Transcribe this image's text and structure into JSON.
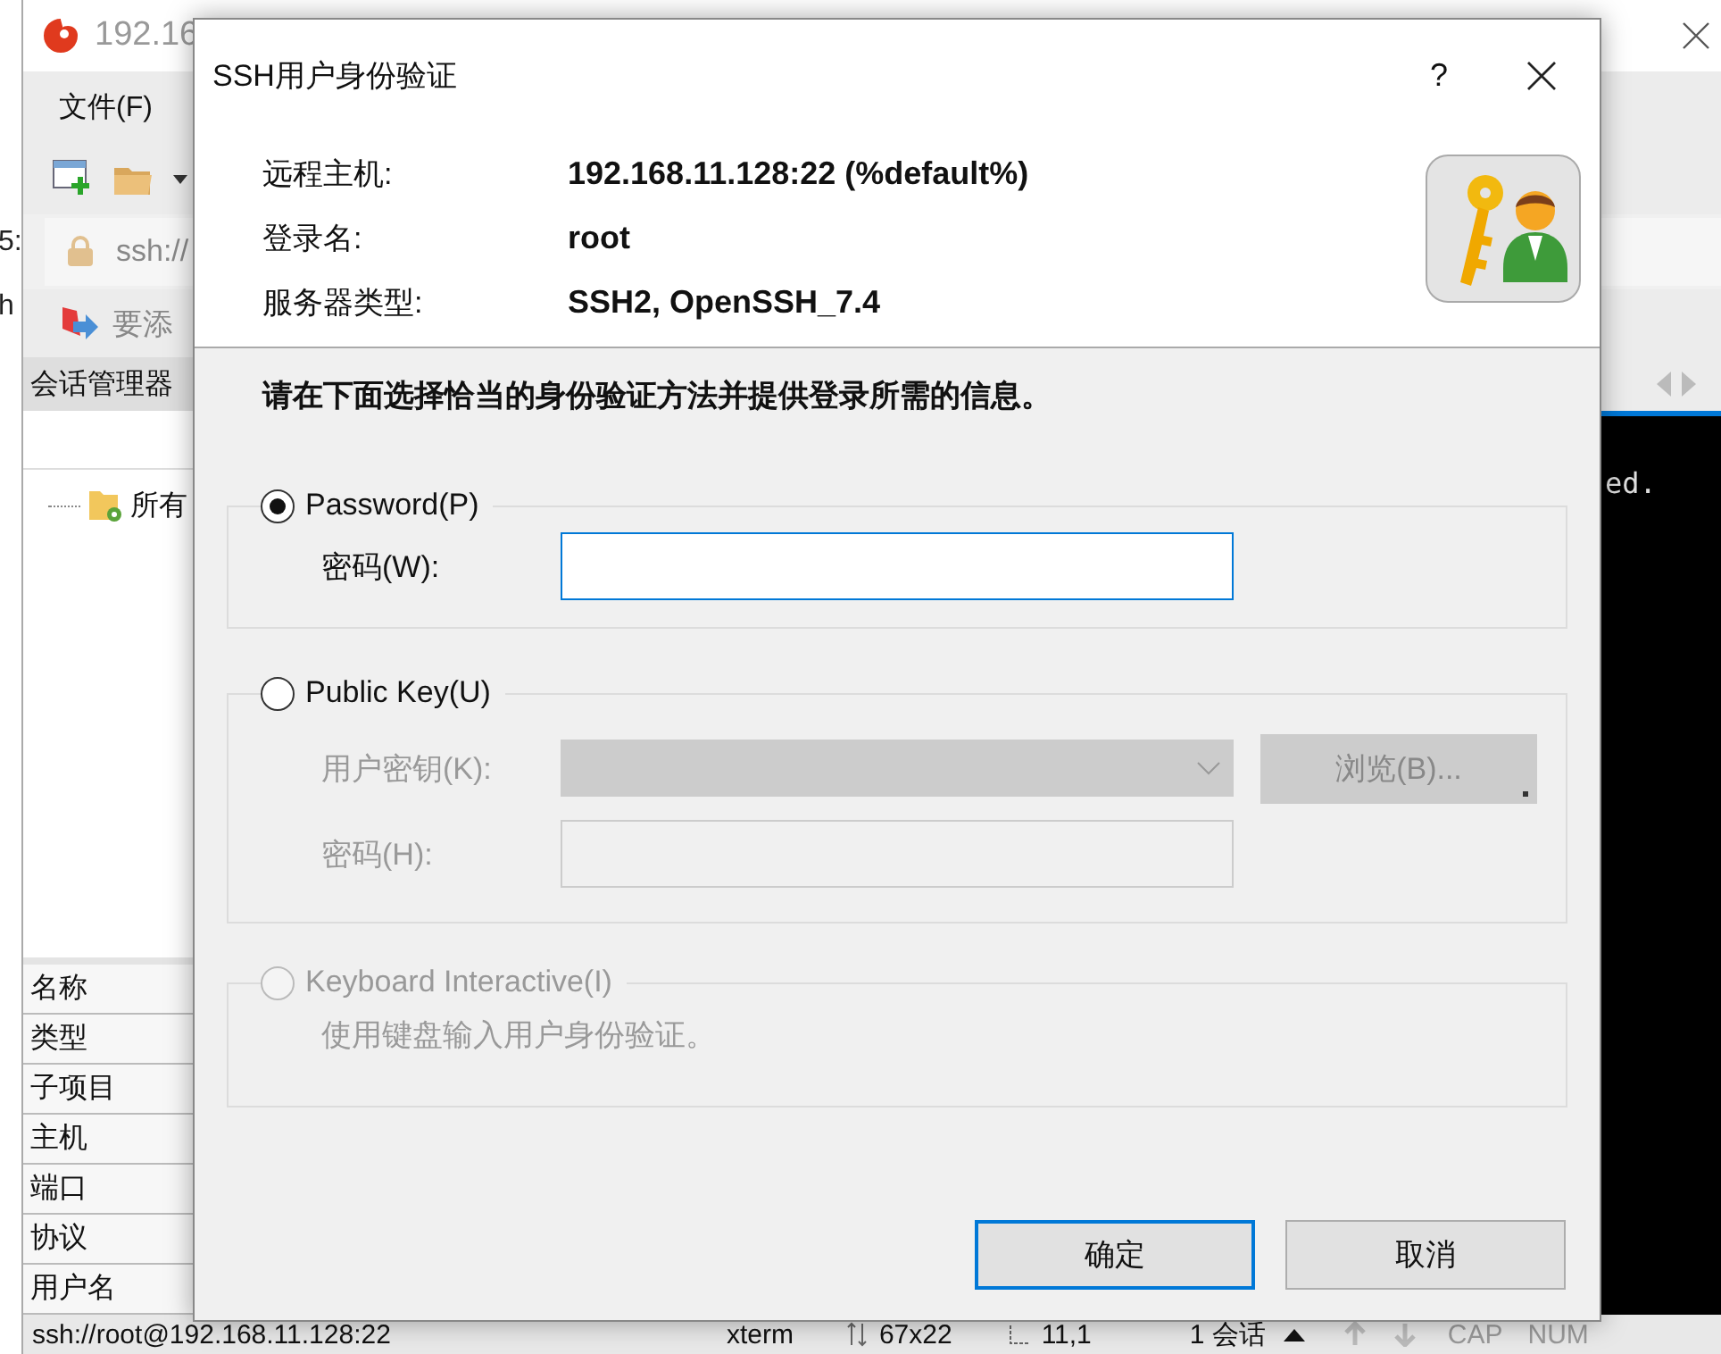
{
  "background_window": {
    "fragments": [
      "5:",
      "h"
    ]
  },
  "xshell": {
    "title": "192.16",
    "menu": [
      "文件(F)"
    ],
    "address": "ssh://",
    "hint": "要添",
    "session_manager": {
      "title": "会话管理器",
      "tree": [
        {
          "label": "所有"
        }
      ]
    },
    "properties": [
      "名称",
      "类型",
      "子项目",
      "主机",
      "端口",
      "协议",
      "用户名"
    ],
    "terminal_text": "ed.",
    "status_bar": {
      "address": "ssh://root@192.168.11.128:22",
      "terminal": "xterm",
      "size": "67x22",
      "cursor": "11,1",
      "sessions": "1 会话",
      "caps": "CAP",
      "num": "NUM"
    }
  },
  "dialog": {
    "title": "SSH用户身份验证",
    "help": "?",
    "info": [
      {
        "label": "远程主机:",
        "value": "192.168.11.128:22 (%default%)"
      },
      {
        "label": "登录名:",
        "value": "root"
      },
      {
        "label": "服务器类型:",
        "value": "SSH2, OpenSSH_7.4"
      }
    ],
    "instruction": "请在下面选择恰当的身份验证方法并提供登录所需的信息。",
    "methods": [
      {
        "kind": "password",
        "label": "Password(P)",
        "selected": true,
        "disabled": false,
        "fields": [
          {
            "label": "密码(W):",
            "kind": "text",
            "disabled": false
          }
        ]
      },
      {
        "kind": "publickey",
        "label": "Public Key(U)",
        "selected": false,
        "disabled": false,
        "fields": [
          {
            "label": "用户密钥(K):",
            "kind": "combo",
            "disabled": true,
            "button": "浏览(B)..."
          },
          {
            "label": "密码(H):",
            "kind": "text",
            "disabled": true
          }
        ]
      },
      {
        "kind": "keyboard",
        "label": "Keyboard Interactive(I)",
        "selected": false,
        "disabled": true,
        "description": "使用键盘输入用户身份验证。"
      }
    ],
    "buttons": [
      {
        "label": "确定",
        "default": true
      },
      {
        "label": "取消",
        "default": false
      }
    ]
  }
}
